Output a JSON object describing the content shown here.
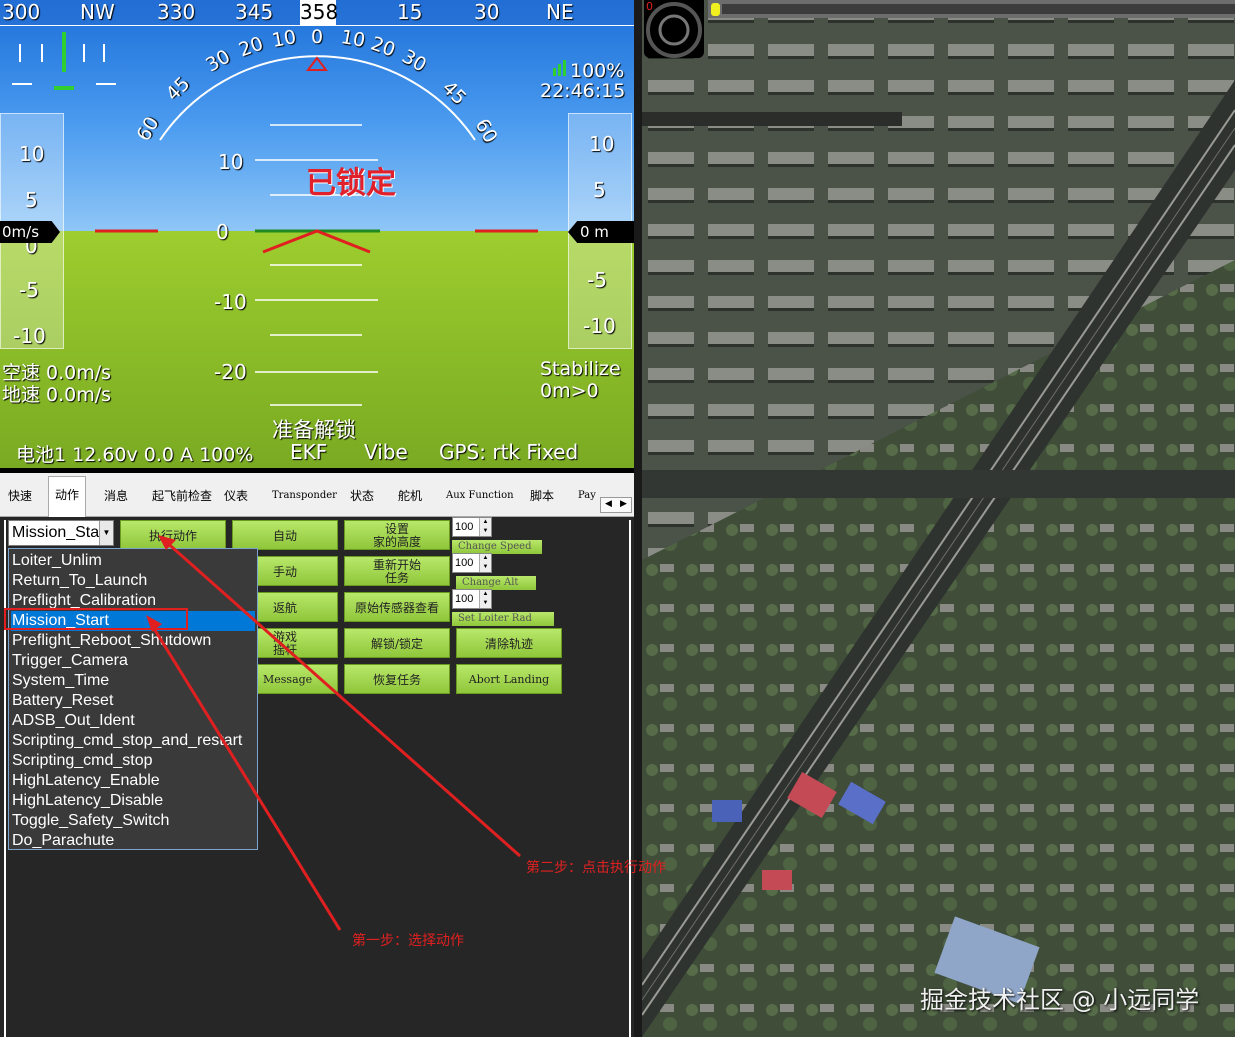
{
  "hud": {
    "heading_labels": [
      "300",
      "NW",
      "330",
      "345",
      "358",
      "15",
      "30",
      "NE"
    ],
    "roll_labels": [
      "60",
      "45",
      "30",
      "20",
      "10",
      "0",
      "10",
      "20",
      "30",
      "45",
      "60"
    ],
    "pitch_labels": [
      "10",
      "0",
      "-10",
      "-20"
    ],
    "speed_scale": [
      "10",
      "5",
      "0",
      "-5",
      "-10"
    ],
    "alt_scale": [
      "10",
      "5",
      "-5",
      "-10"
    ],
    "speed_readout": "0m/s",
    "alt_readout": "0 m",
    "signal": "100%",
    "time": "22:46:15",
    "lock_status": "已锁定",
    "airspeed": "空速 0.0m/s",
    "groundspeed": "地速 0.0m/s",
    "mode": "Stabilize",
    "alt_target": "0m>0",
    "arm_status": "准备解锁",
    "battery": "电池1 12.60v 0.0 A 100%",
    "ekf": "EKF",
    "vibe": "Vibe",
    "gps": "GPS: rtk Fixed"
  },
  "tabs": [
    "快速",
    "动作",
    "消息",
    "起飞前检查",
    "仪表",
    "Transponder",
    "状态",
    "舵机",
    "Aux Function",
    "脚本",
    "Pay"
  ],
  "actions": {
    "select_value": "Mission_Sta",
    "dropdown_items": [
      "Loiter_Unlim",
      "Return_To_Launch",
      "Preflight_Calibration",
      "Mission_Start",
      "Preflight_Reboot_Shutdown",
      "Trigger_Camera",
      "System_Time",
      "Battery_Reset",
      "ADSB_Out_Ident",
      "Scripting_cmd_stop_and_restart",
      "Scripting_cmd_stop",
      "HighLatency_Enable",
      "HighLatency_Disable",
      "Toggle_Safety_Switch",
      "Do_Parachute"
    ],
    "selected_item": "Mission_Start",
    "buttons": {
      "do_action": "执行动作",
      "auto": "自动",
      "set_home_l1": "设置",
      "set_home_l2": "家的高度",
      "manual": "手动",
      "restart_l1": "重新开始",
      "restart_l2": "任务",
      "rtl": "返航",
      "raw_sensor": "原始传感器查看",
      "joystick_l1": "游戏",
      "joystick_l2": "摇杆",
      "arm_disarm": "解锁/锁定",
      "clear_track": "清除轨迹",
      "message": "Message",
      "resume_mission": "恢复任务",
      "abort_landing": "Abort Landing"
    },
    "spinners": [
      "100",
      "100",
      "100"
    ],
    "mini_buttons": [
      "Change Speed",
      "Change Alt",
      "Set Loiter Rad"
    ]
  },
  "annotations": {
    "step1": "第一步：选择动作",
    "step2": "第二步：点击执行动作"
  },
  "watermark": "掘金技术社区 @ 小远同学",
  "map_badge": "0"
}
